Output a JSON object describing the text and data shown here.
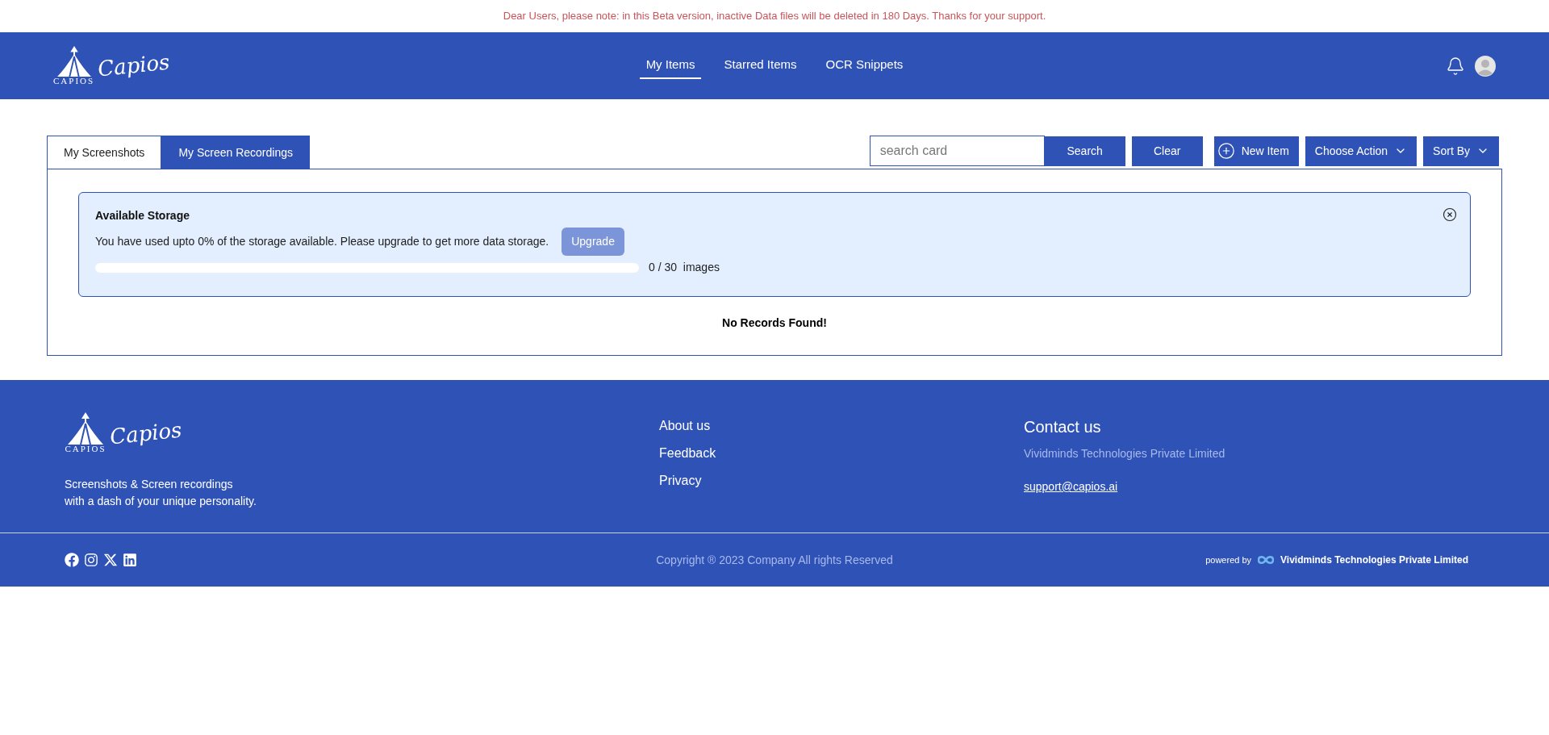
{
  "notice": "Dear Users, please note: in this Beta version, inactive Data files will be deleted in 180 Days. Thanks for your support.",
  "logo": {
    "script": "Capios",
    "caps": "CAPIOS"
  },
  "footer_logo": {
    "script": "Capios",
    "caps": "CAPIOS"
  },
  "nav": [
    {
      "label": "My Items",
      "selected": true
    },
    {
      "label": "Starred Items",
      "selected": false
    },
    {
      "label": "OCR Snippets",
      "selected": false
    }
  ],
  "tabs": [
    {
      "label": "My Screenshots",
      "selected": true
    },
    {
      "label": "My Screen Recordings",
      "selected": false
    }
  ],
  "search": {
    "placeholder": "search card"
  },
  "toolbar": [
    {
      "label": "Search",
      "kind": "plain"
    },
    {
      "label": "Clear",
      "kind": "plain"
    },
    {
      "label": "New Item",
      "kind": "add"
    },
    {
      "label": "Choose Action",
      "kind": "dropdown"
    },
    {
      "label": "Sort By",
      "kind": "dropdown"
    }
  ],
  "storage": {
    "title": "Available Storage",
    "message": "You have used upto 0% of the storage available. Please upgrade to get more data storage.",
    "upgrade": "Upgrade",
    "level": 0,
    "used": "0",
    "sep": "/",
    "total": "30",
    "unit": "images"
  },
  "empty": "No Records Found!",
  "footer": {
    "tagline": [
      "Screenshots & Screen recordings",
      "with a dash of your unique personality."
    ],
    "links": [
      "About us",
      "Feedback",
      "Privacy"
    ],
    "contact_title": "Contact us",
    "company": "Vividminds Technologies Private Limited",
    "email": "support@capios.ai",
    "copyright": "Copyright ® 2023 Company All rights Reserved",
    "powered_by": "powered by",
    "powered_company": "Vividminds Technologies Private Limited"
  }
}
